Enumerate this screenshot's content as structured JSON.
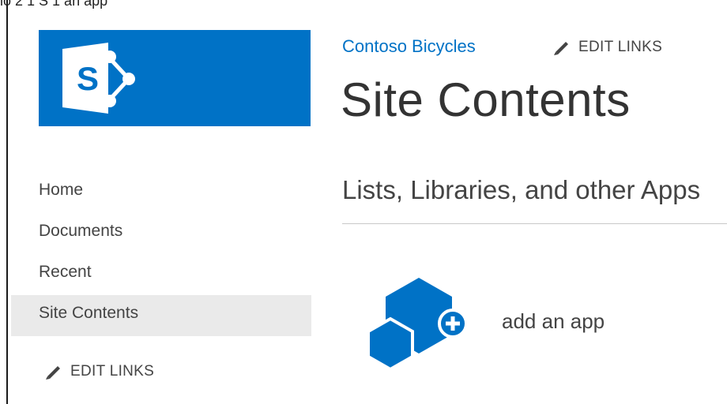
{
  "caption": "lo 2 1 S 1 an app",
  "brand": {
    "color": "#0072c6",
    "logo_letter": "S"
  },
  "quick_launch": {
    "items": [
      {
        "label": "Home",
        "selected": false
      },
      {
        "label": "Documents",
        "selected": false
      },
      {
        "label": "Recent",
        "selected": false
      },
      {
        "label": "Site Contents",
        "selected": true
      }
    ],
    "edit_links_label": "EDIT LINKS",
    "edit_icon": "pencil-icon"
  },
  "header": {
    "site_name": "Contoso Bicycles",
    "edit_links_label": "EDIT LINKS",
    "page_title": "Site Contents"
  },
  "content": {
    "section_heading": "Lists, Libraries, and other Apps",
    "add_app_label": "add an app",
    "add_app_icon": "add-app-hexagon-icon"
  }
}
